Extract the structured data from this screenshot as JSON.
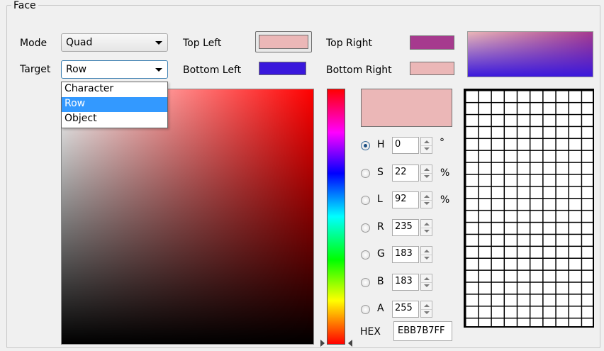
{
  "group": {
    "title": "Face"
  },
  "mode": {
    "label": "Mode",
    "value": "Quad"
  },
  "target": {
    "label": "Target",
    "value": "Row",
    "options": [
      "Character",
      "Row",
      "Object"
    ],
    "selected_index": 1
  },
  "corners": {
    "top_left": {
      "label": "Top Left",
      "color": "#ebb7b7"
    },
    "top_right": {
      "label": "Top Right",
      "color": "#a63a8e"
    },
    "bottom_left": {
      "label": "Bottom Left",
      "color": "#3a18dc"
    },
    "bottom_right": {
      "label": "Bottom Right",
      "color": "#ebb7b7"
    }
  },
  "preview": {
    "current_color": "#ebb7b7"
  },
  "channels": [
    {
      "name": "H",
      "value": "0",
      "unit": "°",
      "selected": true
    },
    {
      "name": "S",
      "value": "22",
      "unit": "%",
      "selected": false
    },
    {
      "name": "L",
      "value": "92",
      "unit": "%",
      "selected": false
    },
    {
      "name": "R",
      "value": "235",
      "unit": "",
      "selected": false
    },
    {
      "name": "G",
      "value": "183",
      "unit": "",
      "selected": false
    },
    {
      "name": "B",
      "value": "183",
      "unit": "",
      "selected": false
    },
    {
      "name": "A",
      "value": "255",
      "unit": "",
      "selected": false
    }
  ],
  "hex": {
    "label": "HEX",
    "value": "EBB7B7FF"
  },
  "icons": {
    "combo_arrow": "chevron-down-icon",
    "hue_marker_left": "triangle-right-icon",
    "hue_marker_right": "triangle-left-icon"
  }
}
